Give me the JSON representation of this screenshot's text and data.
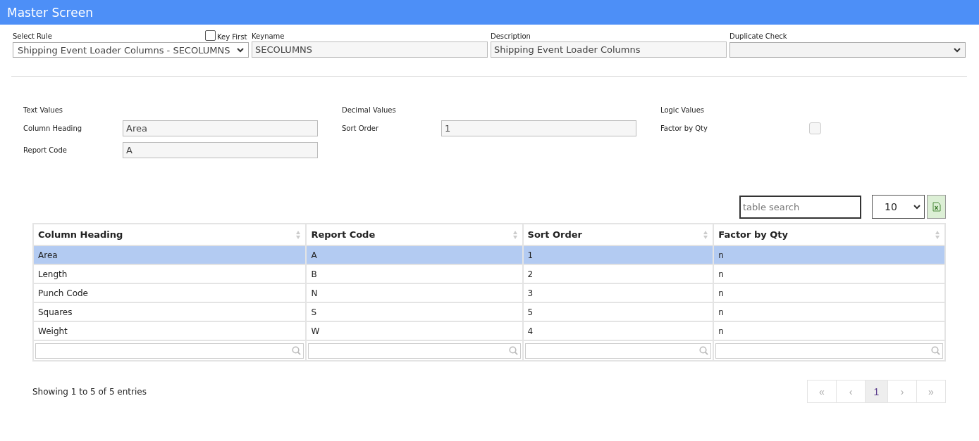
{
  "window": {
    "title": "Master Screen"
  },
  "header_fields": [
    {
      "kind": "select",
      "label": "Select Rule",
      "value": "Shipping Event Loader Columns - SECOLUMNS"
    },
    {
      "kind": "text",
      "label": "Keyname",
      "value": "SECOLUMNS",
      "key_first": {
        "label": "Key First",
        "checked": false
      }
    },
    {
      "kind": "text",
      "label": "Description",
      "value": "Shipping Event Loader Columns"
    },
    {
      "kind": "select",
      "label": "Duplicate Check"
    }
  ],
  "value_groups": [
    {
      "title": "Text Values",
      "fields": [
        {
          "kind": "text",
          "label": "Column Heading",
          "value": "Area"
        },
        {
          "kind": "text",
          "label": "Report Code",
          "value": "A"
        }
      ]
    },
    {
      "title": "Decimal Values",
      "fields": [
        {
          "kind": "text",
          "label": "Sort Order",
          "value": "1"
        }
      ]
    },
    {
      "title": "Logic Values",
      "fields": [
        {
          "kind": "checkbox",
          "label": "Factor by Qty",
          "checked": false
        }
      ]
    }
  ],
  "table_search": {
    "placeholder": "table search"
  },
  "page_size": "10",
  "table": {
    "columns": [
      "Column Heading",
      "Report Code",
      "Sort Order",
      "Factor by Qty"
    ],
    "rows": [
      {
        "cells": [
          "Area",
          "A",
          "1",
          "n"
        ],
        "selected": true
      },
      {
        "cells": [
          "Length",
          "B",
          "2",
          "n"
        ],
        "selected": false
      },
      {
        "cells": [
          "Punch Code",
          "N",
          "3",
          "n"
        ],
        "selected": false
      },
      {
        "cells": [
          "Squares",
          "S",
          "5",
          "n"
        ],
        "selected": false
      },
      {
        "cells": [
          "Weight",
          "W",
          "4",
          "n"
        ],
        "selected": false
      }
    ]
  },
  "info": "Showing 1 to 5 of 5 entries",
  "pagination": [
    {
      "label": "«",
      "selected": false
    },
    {
      "label": "‹",
      "selected": false
    },
    {
      "label": "1",
      "selected": true
    },
    {
      "label": "›",
      "selected": false
    },
    {
      "label": "»",
      "selected": false
    }
  ]
}
